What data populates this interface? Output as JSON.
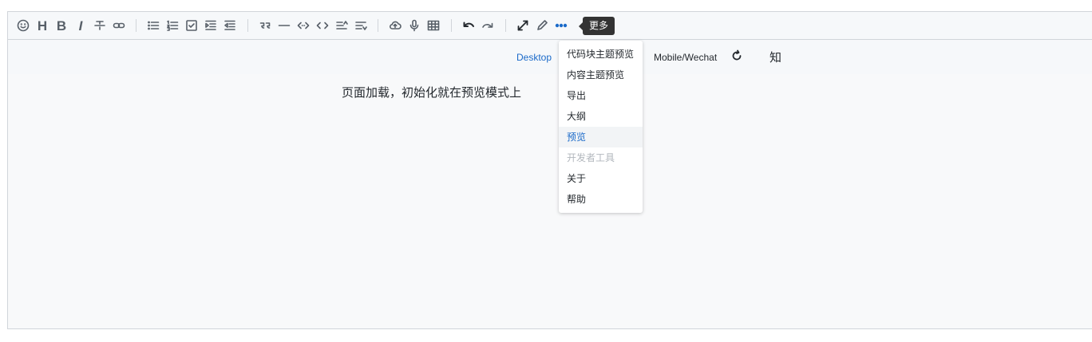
{
  "toolbar": {
    "heading_glyph": "H",
    "bold_glyph": "B",
    "italic_glyph": "I",
    "more_tooltip": "更多"
  },
  "preview_bar": {
    "desktop": "Desktop",
    "mobile": "Mobile/Wechat",
    "zhihu": "知"
  },
  "content": {
    "text": "页面加载，初始化就在预览模式上"
  },
  "more_menu": {
    "items": [
      {
        "label": "代码块主题预览"
      },
      {
        "label": "内容主题预览"
      },
      {
        "label": "导出"
      },
      {
        "label": "大纲"
      },
      {
        "label": "预览"
      },
      {
        "label": "开发者工具"
      },
      {
        "label": "关于"
      },
      {
        "label": "帮助"
      }
    ]
  },
  "colors": {
    "accent": "#1b6ac9",
    "tooltip_bg": "#333333",
    "disabled": "#b2b7bd"
  }
}
